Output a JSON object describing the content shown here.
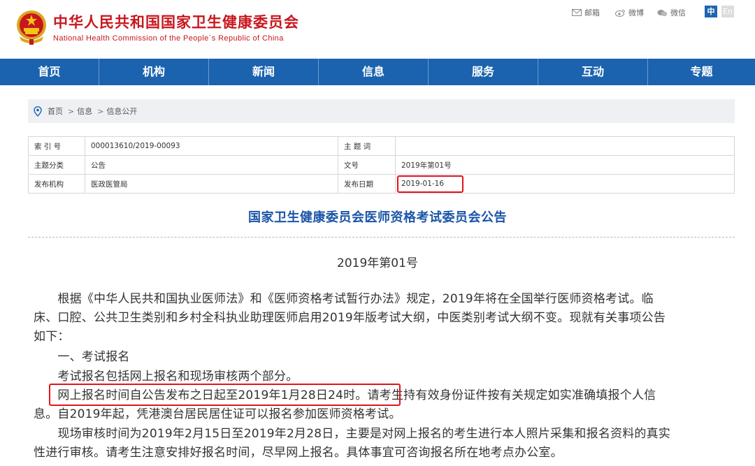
{
  "header": {
    "site_title": "中华人民共和国国家卫生健康委员会",
    "site_subtitle": "National Health Commission of the People´s Republic of China",
    "share": {
      "mail_label": "邮箱",
      "weibo_label": "微博",
      "wechat_label": "微信"
    },
    "lang_zh": "中",
    "lang_en": "En"
  },
  "nav": {
    "items": [
      {
        "label": "首页"
      },
      {
        "label": "机构"
      },
      {
        "label": "新闻"
      },
      {
        "label": "信息"
      },
      {
        "label": "服务"
      },
      {
        "label": "互动"
      },
      {
        "label": "专题"
      }
    ]
  },
  "breadcrumb": {
    "items": [
      "首页",
      "信息",
      "信息公开"
    ],
    "separator": ">"
  },
  "meta": {
    "index_no_label": "索 引 号",
    "index_no_value": "000013610/2019-00093",
    "subject_label": "主 题 词",
    "subject_value": "",
    "category_label": "主题分类",
    "category_value": "公告",
    "doc_no_label": "文号",
    "doc_no_value": "2019年第01号",
    "issuer_label": "发布机构",
    "issuer_value": "医政医管局",
    "date_label": "发布日期",
    "date_value": "2019-01-16"
  },
  "article": {
    "title": "国家卫生健康委员会医师资格考试委员会公告",
    "doc_number": "2019年第01号",
    "lines": [
      "　　根据《中华人民共和国执业医师法》和《医师资格考试暂行办法》规定，2019年将在全国举行医师资格考试。临",
      "床、口腔、公共卫生类别和乡村全科执业助理医师启用2019年版考试大纲，中医类别考试大纲不变。现就有关事项公告",
      "如下：",
      "　　一、考试报名",
      "　　考试报名包括网上报名和现场审核两个部分。",
      "　　网上报名时间自公告发布之日起至2019年1月28日24时。请考生持有效身份证件按有关规定如实准确填报个人信",
      "息。自2019年起，凭港澳台居民居住证可以报名参加医师资格考试。",
      "　　现场审核时间为2019年2月15日至2019年2月28日，主要是对网上报名的考生进行本人照片采集和报名资料的真实",
      "性进行审核。请考生注意安排好报名时间，尽早网上报名。具体事宜可咨询报名所在地考点办公室。"
    ]
  },
  "colors": {
    "brand_red": "#c8161d",
    "nav_blue": "#1b63ae",
    "title_blue": "#1b55a8",
    "highlight_red": "#e0141b"
  }
}
